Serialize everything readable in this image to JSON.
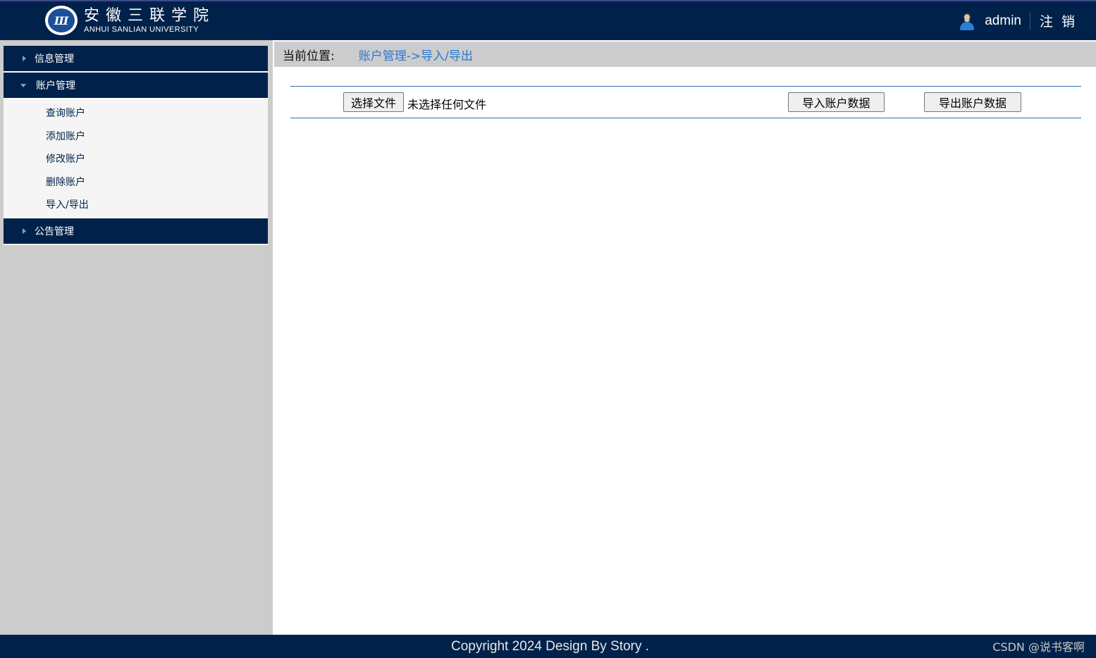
{
  "header": {
    "logo_cn": "安徽三联学院",
    "logo_en": "ANHUI SANLIAN UNIVERSITY",
    "logo_mark": "Ш",
    "username": "admin",
    "logout_label": "注销",
    "icons": {
      "user": "user-avatar-icon"
    }
  },
  "sidebar": {
    "menus": [
      {
        "label": "信息管理",
        "expanded": false
      },
      {
        "label": "账户管理",
        "expanded": true,
        "items": [
          "查询账户",
          "添加账户",
          "修改账户",
          "删除账户",
          "导入/导出"
        ]
      },
      {
        "label": "公告管理",
        "expanded": false
      }
    ]
  },
  "content": {
    "breadcrumb_label": "当前位置:",
    "breadcrumb_path": "账户管理->导入/导出",
    "choose_file_label": "选择文件",
    "file_status": "未选择任何文件",
    "import_label": "导入账户数据",
    "export_label": "导出账户数据"
  },
  "footer": {
    "copyright": "Copyright 2024 Design By Story .",
    "watermark": "CSDN @说书客啊"
  },
  "colors": {
    "header_bg": "#00224a",
    "sidebar_bg": "#cccccc",
    "link": "#2a78d0",
    "divider": "#2a6fb4"
  }
}
